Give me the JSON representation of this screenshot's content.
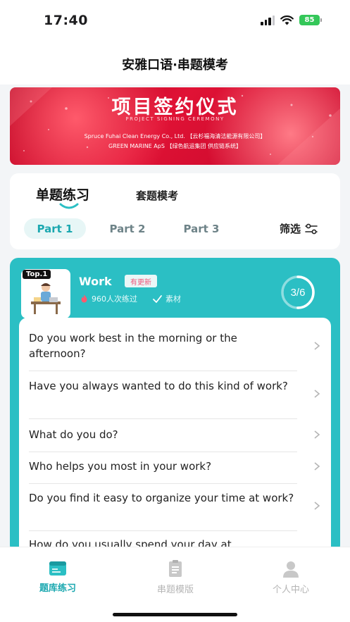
{
  "status": {
    "time": "17:40",
    "battery": "85",
    "icons": [
      "signal-icon",
      "wifi-icon",
      "battery-icon"
    ]
  },
  "nav": {
    "title": "安雅口语·串题模考"
  },
  "banner": {
    "title": "项目签约仪式",
    "subtitle": "PROJECT SIGNING CEREMONY",
    "line1": "Spruce Fuhai Clean Energy Co., Ltd. 【云杉福海清洁能源有限公司】",
    "line2": "GREEN MARINE ApS 【绿色航运集团 供应链系统】"
  },
  "tabs": {
    "main": [
      "单题练习",
      "套题模考"
    ],
    "parts": [
      "Part 1",
      "Part 2",
      "Part 3"
    ],
    "active_part": "Part 1",
    "filter": "筛选"
  },
  "topic": {
    "badge": "Top.1",
    "name": "Work",
    "update_tag": "有更新",
    "practice_count": "960人次练过",
    "material": "素材",
    "progress": "3/6",
    "progress_fraction": 0.5
  },
  "questions": [
    "Do you work best in the morning or the afternoon?",
    "Have you always wanted to do this kind of work?",
    "What do you do?",
    "Who helps you most in your work?",
    "Do you find it easy to organize your time at work?",
    "How do you usually spend your day at"
  ],
  "bottom_nav": [
    {
      "label": "题库练习",
      "icon": "book-icon",
      "active": true
    },
    {
      "label": "串题模版",
      "icon": "document-icon",
      "active": false
    },
    {
      "label": "个人中心",
      "icon": "person-icon",
      "active": false
    }
  ],
  "colors": {
    "accent": "#2bbfc4",
    "banner_red": "#e01235",
    "update_pink": "#f0567a"
  }
}
